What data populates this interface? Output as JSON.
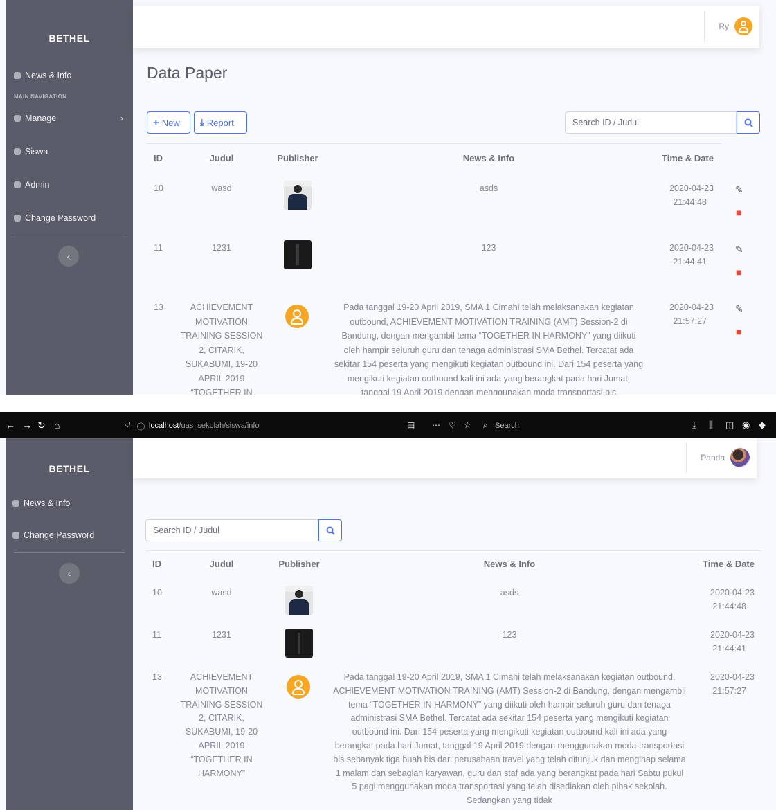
{
  "brand": "BETHEL",
  "panel1": {
    "sidebar": {
      "items": [
        {
          "label": "News & Info"
        },
        {
          "label": "Manage"
        },
        {
          "label": "Siswa"
        },
        {
          "label": "Admin"
        },
        {
          "label": "Change Password"
        }
      ],
      "section_heading": "MAIN NAVIGATION"
    },
    "user_name": "Ry",
    "page_title": "Data Paper",
    "new_button": "New",
    "report_button": "Report",
    "search_placeholder": "Search ID / Judul",
    "columns": [
      "ID",
      "Judul",
      "Publisher",
      "News & Info",
      "Time & Date"
    ],
    "rows": [
      {
        "id": "10",
        "judul": "wasd",
        "news": "asds",
        "date": "2020-04-23",
        "time": "21:44:48"
      },
      {
        "id": "11",
        "judul": "1231",
        "news": "123",
        "date": "2020-04-23",
        "time": "21:44:41"
      },
      {
        "id": "13",
        "judul": "ACHIEVEMENT MOTIVATION TRAINING SESSION 2, CITARIK, SUKABUMI, 19-20 APRIL 2019 “TOGETHER IN",
        "news": "Pada tanggal 19-20 April 2019, SMA 1 Cimahi telah melaksanakan kegiatan outbound, ACHIEVEMENT MOTIVATION TRAINING (AMT) Session-2 di Bandung, dengan mengambil tema “TOGETHER IN HARMONY” yang diikuti oleh hampir seluruh guru dan tenaga administrasi SMA Bethel. Tercatat ada sekitar 154 peserta yang mengikuti kegiatan outbound ini. Dari 154 peserta yang mengikuti kegiatan outbound kali ini ada yang berangkat pada hari Jumat, tanggal 19 April 2019 dengan menggunakan moda transportasi bis",
        "date": "2020-04-23",
        "time": "21:57:27"
      }
    ]
  },
  "browser": {
    "url_host": "localhost",
    "url_path": "/uas_sekolah/siswa/info",
    "search_label": "Search"
  },
  "panel2": {
    "sidebar": {
      "items": [
        {
          "label": "News & Info"
        },
        {
          "label": "Change Password"
        }
      ]
    },
    "user_name": "Panda",
    "search_placeholder": "Search ID / Judul",
    "columns": [
      "ID",
      "Judul",
      "Publisher",
      "News & Info",
      "Time & Date"
    ],
    "rows": [
      {
        "id": "10",
        "judul": "wasd",
        "news": "asds",
        "date": "2020-04-23",
        "time": "21:44:48"
      },
      {
        "id": "11",
        "judul": "1231",
        "news": "123",
        "date": "2020-04-23",
        "time": "21:44:41"
      },
      {
        "id": "13",
        "judul": "ACHIEVEMENT MOTIVATION TRAINING SESSION 2, CITARIK, SUKABUMI, 19-20 APRIL 2019 “TOGETHER IN HARMONY”",
        "news": "Pada tanggal 19-20 April 2019, SMA 1 Cimahi telah melaksanakan kegiatan outbound, ACHIEVEMENT MOTIVATION TRAINING (AMT) Session-2 di Bandung, dengan mengambil tema “TOGETHER IN HARMONY” yang diikuti oleh hampir seluruh guru dan tenaga administrasi SMA Bethel. Tercatat ada sekitar 154 peserta yang mengikuti kegiatan outbound ini. Dari 154 peserta yang mengikuti kegiatan outbound kali ini ada yang berangkat pada hari Jumat, tanggal 19 April 2019 dengan menggunakan moda transportasi bis sebanyak tiga buah bis dari perusahaan travel yang telah ditunjuk dan menginap selama 1 malam dan sebagian karyawan, guru dan staf ada yang berangkat pada hari Sabtu pukul 5 pagi menggunakan moda transportasi yang telah disediakan oleh pihak sekolah. Sedangkan yang tidak",
        "date": "2020-04-23",
        "time": "21:57:27"
      }
    ]
  }
}
